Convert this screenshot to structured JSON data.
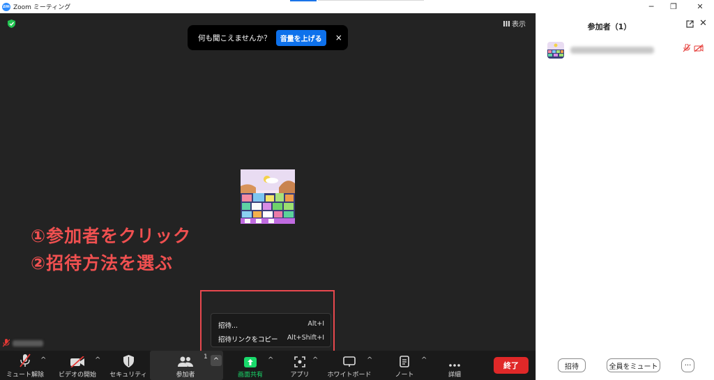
{
  "window": {
    "app_logo": "zm",
    "title": "Zoom ミーティング"
  },
  "meeting": {
    "toast": {
      "text": "何も聞こえませんか？",
      "button": "音量を上げる",
      "close": "×"
    },
    "view_label": "表示",
    "annotation_lines": [
      "①参加者をクリック",
      "②招待方法を選ぶ"
    ],
    "invite_menu": [
      {
        "label": "招待...",
        "shortcut": "Alt+I"
      },
      {
        "label": "招待リンクをコピー",
        "shortcut": "Alt+Shift+I"
      }
    ]
  },
  "toolbar": {
    "mute": "ミュート解除",
    "video": "ビデオの開始",
    "security": "セキュリティ",
    "participants": "参加者",
    "participants_count": "1",
    "share": "画面共有",
    "apps": "アプリ",
    "whiteboard": "ホワイトボード",
    "notes": "ノート",
    "more": "詳細",
    "end": "終了",
    "caret": "^",
    "colors": {
      "share": "#19d96b",
      "end": "#e02828",
      "accent": "#0e71eb"
    }
  },
  "panel": {
    "title": "参加者（1）",
    "invite_button": "招待",
    "mute_all_button": "全員をミュート",
    "more_button": "···"
  },
  "icons": {
    "window": {
      "minimize": "─",
      "restore": "❐",
      "close": "✕"
    },
    "panel_close": "✕"
  }
}
